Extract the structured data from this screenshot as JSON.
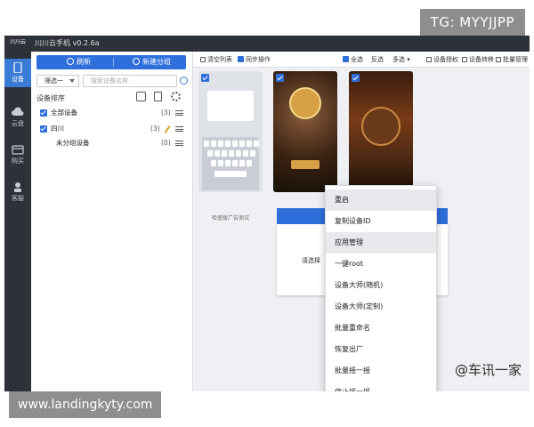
{
  "watermark": {
    "tg": "TG: MYYJJPP",
    "site": "www.landingkyty.com",
    "source": "@车讯一家"
  },
  "window": {
    "title": "川川云手机 v0.2.6a"
  },
  "nav": {
    "logo": "川川云",
    "items": [
      {
        "label": "设备",
        "icon": "phone-icon",
        "active": true
      },
      {
        "label": "云盘",
        "icon": "cloud-icon",
        "active": false
      },
      {
        "label": "购买",
        "icon": "cart-icon",
        "active": false
      },
      {
        "label": "客服",
        "icon": "headset-icon",
        "active": false
      }
    ]
  },
  "panel": {
    "refresh_label": "刷新",
    "new_group_label": "新建分组",
    "filter_value": "筛选一",
    "search_placeholder": "搜索设备名称",
    "sort_label": "设备排序",
    "groups": [
      {
        "name": "全部设备",
        "count": "(3)",
        "checked": true
      },
      {
        "name": "四川",
        "count": "(3)",
        "checked": true
      },
      {
        "name": "未分组设备",
        "count": "(0)",
        "checked": false
      }
    ]
  },
  "toolbar": {
    "clear_list": "清空列表",
    "sync_ops": "同步操作",
    "select_all": "全选",
    "invert": "反选",
    "multi": "多选",
    "authorize": "设备授权",
    "transfer": "设备转移",
    "batch_manage": "批量管理"
  },
  "devices": {
    "caption": "检查版广告测试"
  },
  "dialog": {
    "label": "请选择"
  },
  "context_menu": [
    {
      "label": "重启",
      "highlighted": true
    },
    {
      "label": "复制设备ID",
      "highlighted": false
    },
    {
      "label": "应用管理",
      "highlighted": true
    },
    {
      "label": "一键root",
      "highlighted": false
    },
    {
      "label": "设备大师(随机)",
      "highlighted": false
    },
    {
      "label": "设备大师(定制)",
      "highlighted": false
    },
    {
      "label": "批量重命名",
      "highlighted": false
    },
    {
      "label": "恢复出厂",
      "highlighted": false
    },
    {
      "label": "批量摇一摇",
      "highlighted": false
    },
    {
      "label": "停止摇一摇",
      "highlighted": false
    }
  ],
  "colors": {
    "accent": "#2e6fdb",
    "sidebar": "#2d3138"
  }
}
